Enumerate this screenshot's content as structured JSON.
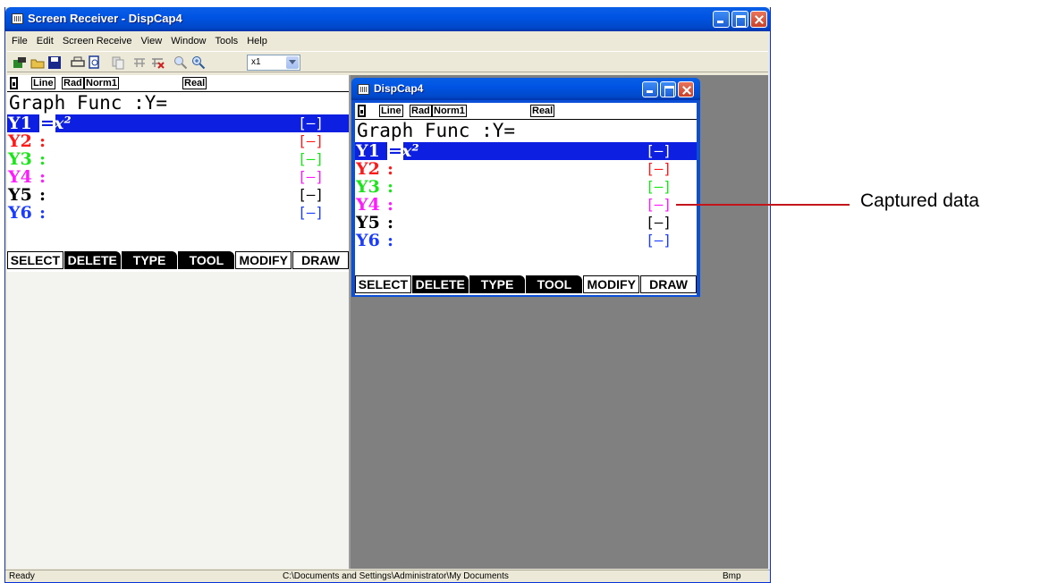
{
  "window": {
    "title": "Screen Receiver - DispCap4"
  },
  "menu": [
    "File",
    "Edit",
    "Screen Receive",
    "View",
    "Window",
    "Tools",
    "Help"
  ],
  "toolbar": {
    "icons": [
      "connect-icon",
      "open-icon",
      "save-icon",
      "print-icon",
      "print-preview-icon",
      "copy-icon",
      "receive-icon",
      "stop-icon",
      "zoom-out-icon",
      "zoom-in-icon"
    ],
    "zoom_value": "x1"
  },
  "calc_screen": {
    "status_tags": [
      "Line",
      "Rad",
      "Norm1",
      "Real"
    ],
    "header": "Graph Func  :Y=",
    "rows": [
      {
        "label": "Y1",
        "sep": "=",
        "expr": "x²",
        "style": "[—]",
        "color": "#ffffff",
        "style_color": "#ffffff",
        "selected": true
      },
      {
        "label": "Y2",
        "sep": ":",
        "expr": "",
        "style": "[—]",
        "color": "#ff1a1a",
        "style_color": "#ff1a1a",
        "selected": false
      },
      {
        "label": "Y3",
        "sep": ":",
        "expr": "",
        "style": "[—]",
        "color": "#19e619",
        "style_color": "#19e619",
        "selected": false
      },
      {
        "label": "Y4",
        "sep": ":",
        "expr": "",
        "style": "[—]",
        "color": "#ff1aff",
        "style_color": "#ff1aff",
        "selected": false
      },
      {
        "label": "Y5",
        "sep": ":",
        "expr": "",
        "style": "[—]",
        "color": "#000000",
        "style_color": "#000000",
        "selected": false
      },
      {
        "label": "Y6",
        "sep": ":",
        "expr": "",
        "style": "[—]",
        "color": "#1a3cff",
        "style_color": "#1a3cff",
        "selected": false
      }
    ],
    "fkeys": [
      "SELECT",
      "DELETE",
      "TYPE",
      "TOOL",
      "MODIFY",
      "DRAW"
    ]
  },
  "subwindow": {
    "title": "DispCap4"
  },
  "status": {
    "left": "Ready",
    "path": "C:\\Documents and Settings\\Administrator\\My Documents",
    "format": "Bmp"
  },
  "callout": {
    "label": "Captured data"
  },
  "colors": {
    "title_blue": "#0054e3",
    "selection": "#0d1fe0",
    "callout": "#c4151c"
  }
}
